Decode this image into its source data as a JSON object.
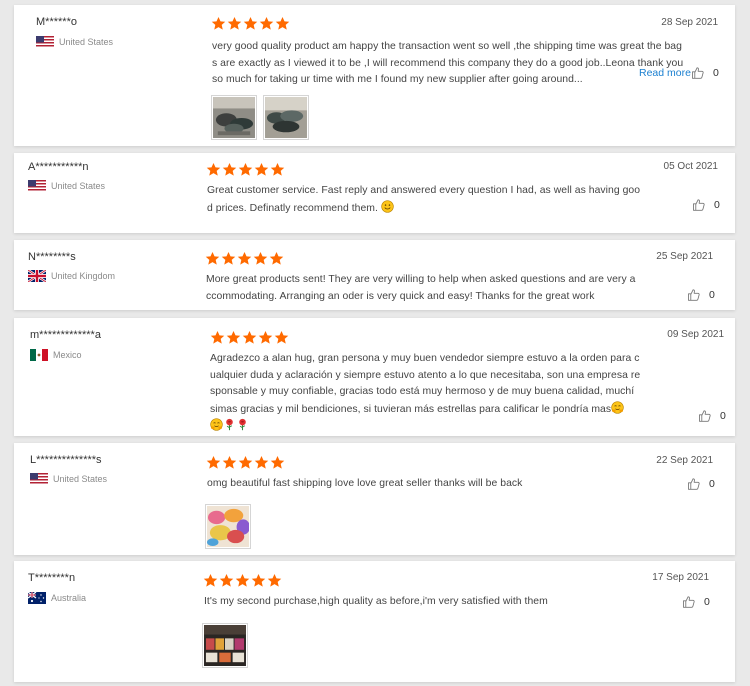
{
  "reviews": [
    {
      "name": "M******o",
      "country": "United States",
      "flag": "us-flag",
      "rating": 5,
      "date": "28 Sep 2021",
      "lines": [
        "very good quality product am happy the transaction went so well ,the shipping time was great the bag",
        "s are exactly as I viewed it to be ,I will recommend this company they  do a good job..Leona thank you",
        "so much for taking ur time with me I found my new supplier after going around..."
      ],
      "read_more": "Read more",
      "likes": "0",
      "photos": [
        "photo-bags-1",
        "photo-bags-2"
      ]
    },
    {
      "name": "A***********n",
      "country": "United States",
      "flag": "us-flag",
      "rating": 5,
      "date": "05 Oct 2021",
      "lines": [
        "Great customer service. Fast reply and answered every question I had, as well as having goo",
        "d prices. Definatly recommend them."
      ],
      "emoji": [
        "smile-emoji"
      ],
      "likes": "0"
    },
    {
      "name": "N********s",
      "country": "United Kingdom",
      "flag": "uk-flag",
      "rating": 5,
      "date": "25 Sep 2021",
      "lines": [
        "More great products sent! They are very willing to help when asked questions and are very a",
        "ccommodating. Arranging an oder is very quick and easy! Thanks for the great work"
      ],
      "likes": "0"
    },
    {
      "name": "m*************a",
      "country": "Mexico",
      "flag": "mexico-flag",
      "rating": 5,
      "date": "09 Sep 2021",
      "lines": [
        "Agradezco a alan hug, gran persona y muy buen vendedor siempre estuvo a la orden para c",
        "ualquier duda y aclaración y siempre estuvo atento a lo que necesitaba, son una empresa re",
        "sponsable y muy   confiable, gracias todo está muy hermoso y de muy buena calidad, muchí",
        "simas gracias y mil bendiciones, si tuvieran más estrellas para calificar le pondría mas"
      ],
      "emoji": [
        "hug-emoji",
        "hug-emoji",
        "rose-emoji",
        "rose-emoji"
      ],
      "likes": "0"
    },
    {
      "name": "L**************s",
      "country": "United States",
      "flag": "us-flag",
      "rating": 5,
      "date": "22 Sep 2021",
      "lines": [
        "omg beautiful fast shipping love love great seller thanks will be back"
      ],
      "likes": "0",
      "photos": [
        "photo-colorful-bags"
      ]
    },
    {
      "name": "T********n",
      "country": "Australia",
      "flag": "australia-flag",
      "rating": 5,
      "date": "17 Sep 2021",
      "lines": [
        "It's my second purchase,high quality as before,i'm very satisfied with them"
      ],
      "likes": "0",
      "photos": [
        "photo-product-shelf"
      ]
    }
  ],
  "colors": {
    "star": "#ff6a00",
    "link": "#1a7fd0",
    "page_bg": "#e9e9e9",
    "card_bg": "#ffffff"
  }
}
